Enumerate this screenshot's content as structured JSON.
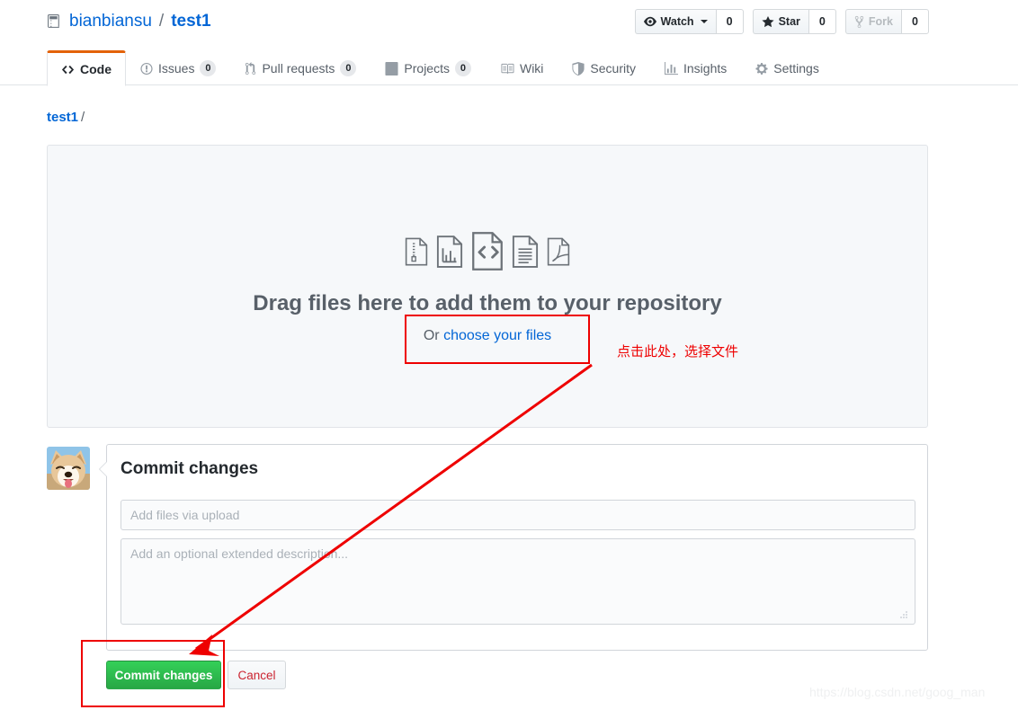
{
  "header": {
    "repo_icon": "repo-icon",
    "owner": "bianbiansu",
    "separator": "/",
    "repo": "test1",
    "social": [
      {
        "icon": "eye-icon",
        "label": "Watch",
        "count": "0",
        "has_caret": true,
        "disabled": false
      },
      {
        "icon": "star-icon",
        "label": "Star",
        "count": "0",
        "has_caret": false,
        "disabled": false
      },
      {
        "icon": "fork-icon",
        "label": "Fork",
        "count": "0",
        "has_caret": false,
        "disabled": true
      }
    ]
  },
  "nav": {
    "items": [
      {
        "icon": "code-icon",
        "label": "Code",
        "count": null,
        "active": true
      },
      {
        "icon": "issue-opened-icon",
        "label": "Issues",
        "count": "0",
        "active": false
      },
      {
        "icon": "git-pull-request-icon",
        "label": "Pull requests",
        "count": "0",
        "active": false
      },
      {
        "icon": "project-icon",
        "label": "Projects",
        "count": "0",
        "active": false
      },
      {
        "icon": "book-icon",
        "label": "Wiki",
        "count": null,
        "active": false
      },
      {
        "icon": "shield-icon",
        "label": "Security",
        "count": null,
        "active": false
      },
      {
        "icon": "graph-icon",
        "label": "Insights",
        "count": null,
        "active": false
      },
      {
        "icon": "gear-icon",
        "label": "Settings",
        "count": null,
        "active": false
      }
    ]
  },
  "breadcrumb": {
    "repo_link": "test1",
    "slash": "/"
  },
  "dropzone": {
    "file_icons": [
      "zip-file-icon",
      "chart-file-icon",
      "code-file-icon",
      "text-file-icon",
      "pdf-file-icon"
    ],
    "drag_text": "Drag files here to add them to your repository",
    "or_text": "Or ",
    "choose_link": "choose your files"
  },
  "commit": {
    "avatar": "user-avatar",
    "title": "Commit changes",
    "message_placeholder": "Add files via upload",
    "message_value": "",
    "description_placeholder": "Add an optional extended description...",
    "description_value": "",
    "commit_button": "Commit changes",
    "cancel_button": "Cancel"
  },
  "annotations": {
    "choose_note": "点击此处，选择文件"
  },
  "watermark": "https://blog.csdn.net/goog_man",
  "colors": {
    "accent_blue": "#0366d6",
    "active_tab_border": "#e36209",
    "commit_green": "#28a745",
    "cancel_red": "#cb2431",
    "annotation_red": "#ee0000",
    "dropzone_bg": "#f6f8fa",
    "border_gray": "#e1e4e8"
  }
}
